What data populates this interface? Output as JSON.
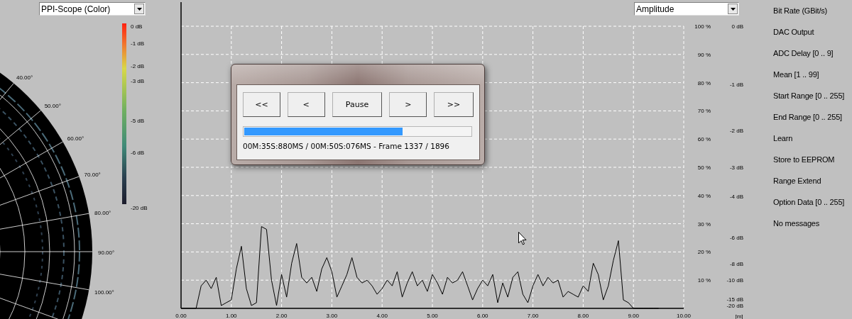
{
  "ppi": {
    "view_select": "PPI-Scope (Color)",
    "scale_labels": [
      "0 dB",
      "-1 dB",
      "-2 dB",
      "-3 dB",
      "-5 dB",
      "-6 dB",
      "-20 dB"
    ],
    "angle_labels": [
      "40.00°",
      "50.00°",
      "60.00°",
      "70.00°",
      "80.00°",
      "90.00°",
      "100.00°"
    ]
  },
  "amplitude": {
    "view_select": "Amplitude",
    "db_scale": [
      "0 dB",
      "-1 dB",
      "-2 dB",
      "-3 dB",
      "-4 dB",
      "-6 dB",
      "-8 dB",
      "-10 dB",
      "-15 dB",
      "-20 dB"
    ],
    "chart_data": {
      "type": "line",
      "grid": true,
      "xlabel": "[m]",
      "xlim": [
        0,
        10
      ],
      "ylim": [
        0,
        100
      ],
      "xticks": [
        {
          "value": 0,
          "label": "0.00"
        },
        {
          "value": 1,
          "label": "1.00"
        },
        {
          "value": 2,
          "label": "2.00"
        },
        {
          "value": 3,
          "label": "3.00"
        },
        {
          "value": 4,
          "label": "4.00"
        },
        {
          "value": 5,
          "label": "5.00"
        },
        {
          "value": 6,
          "label": "6.00"
        },
        {
          "value": 7,
          "label": "7.00"
        },
        {
          "value": 8,
          "label": "8.00"
        },
        {
          "value": 9,
          "label": "9.00"
        },
        {
          "value": 10,
          "label": "10.00"
        }
      ],
      "yticks": [
        {
          "value": 10,
          "label": "10 %"
        },
        {
          "value": 20,
          "label": "20 %"
        },
        {
          "value": 30,
          "label": "30 %"
        },
        {
          "value": 40,
          "label": "40 %"
        },
        {
          "value": 50,
          "label": "50 %"
        },
        {
          "value": 60,
          "label": "60 %"
        },
        {
          "value": 70,
          "label": "70 %"
        },
        {
          "value": 80,
          "label": "80 %"
        },
        {
          "value": 90,
          "label": "90 %"
        },
        {
          "value": 100,
          "label": "100 %"
        }
      ],
      "x": [
        0,
        0.1,
        0.2,
        0.3,
        0.4,
        0.5,
        0.6,
        0.7,
        0.8,
        0.9,
        1,
        1.1,
        1.2,
        1.3,
        1.4,
        1.5,
        1.6,
        1.7,
        1.8,
        1.9,
        2,
        2.1,
        2.2,
        2.3,
        2.4,
        2.5,
        2.6,
        2.7,
        2.8,
        2.9,
        3,
        3.1,
        3.2,
        3.3,
        3.4,
        3.5,
        3.6,
        3.7,
        3.8,
        3.9,
        4,
        4.1,
        4.2,
        4.3,
        4.4,
        4.5,
        4.6,
        4.7,
        4.8,
        4.9,
        5,
        5.1,
        5.2,
        5.3,
        5.4,
        5.5,
        5.6,
        5.7,
        5.8,
        5.9,
        6,
        6.1,
        6.2,
        6.3,
        6.4,
        6.5,
        6.6,
        6.7,
        6.8,
        6.9,
        7,
        7.1,
        7.2,
        7.3,
        7.4,
        7.5,
        7.6,
        7.7,
        7.8,
        7.9,
        8,
        8.1,
        8.2,
        8.3,
        8.4,
        8.5,
        8.6,
        8.7,
        8.8,
        8.9,
        9,
        9.1,
        9.2,
        9.3,
        9.4,
        9.5
      ],
      "series": [
        {
          "color": "#000000",
          "values": [
            0,
            0,
            0,
            0,
            8,
            10,
            7,
            11,
            1,
            2,
            3,
            14,
            22,
            7,
            1,
            2,
            29,
            28,
            10,
            1,
            12,
            4,
            16,
            23,
            11,
            9,
            11,
            6,
            14,
            18,
            13,
            4,
            8,
            12,
            18,
            11,
            9,
            10,
            8,
            5,
            7,
            10,
            8,
            13,
            4,
            9,
            13,
            8,
            10,
            6,
            12,
            9,
            5,
            11,
            9,
            10,
            13,
            8,
            3,
            7,
            10,
            8,
            12,
            2,
            9,
            4,
            11,
            13,
            5,
            2,
            8,
            12,
            8,
            11,
            9,
            10,
            4,
            6,
            5,
            4,
            8,
            6,
            16,
            12,
            3,
            8,
            17,
            24,
            3,
            2,
            0,
            0,
            0,
            0,
            0,
            0
          ]
        }
      ]
    }
  },
  "parameters": [
    "Bit Rate (GBit/s)",
    "DAC Output",
    "ADC Delay [0 .. 9]",
    "Mean [1 .. 99]",
    "Start Range [0 .. 255]",
    "End Range [0 .. 255]",
    "Learn",
    "Store to EEPROM",
    "Range Extend",
    "Option Data [0 .. 255]",
    "No messages"
  ],
  "player": {
    "buttons": [
      "<<",
      "<",
      "Pause",
      ">",
      ">>"
    ],
    "progress": {
      "level": 0.7
    },
    "status": "00M:35S:880MS / 00M:50S:076MS - Frame 1337 / 1896"
  }
}
